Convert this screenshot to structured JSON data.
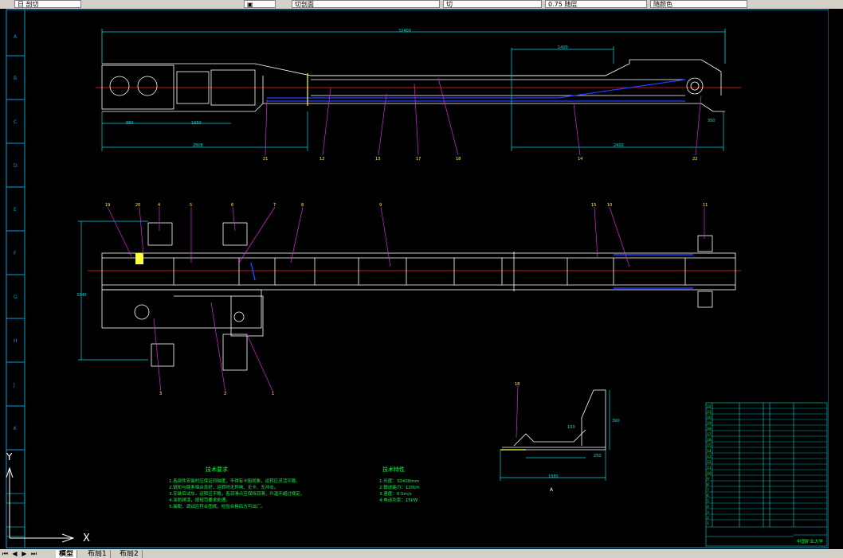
{
  "toolbar": {
    "seg1": "日 剖切",
    "seg2": "切剖面",
    "seg3": "切",
    "seg4": "0.75 随层",
    "seg5": "随颜色"
  },
  "drawing": {
    "dims": {
      "overall": "32400",
      "seg_1400": "1400",
      "seg_880": "880",
      "seg_1650": "1650",
      "seg_2808": "2808",
      "seg_2400": "2400",
      "seg_350": "350",
      "plan_width": "3340",
      "detail_1680": "1680",
      "detail_390": "390",
      "detail_250": "250",
      "detail_100": "100"
    },
    "callouts_top": [
      "21",
      "12",
      "13",
      "17",
      "18",
      "14",
      "22"
    ],
    "callouts_plan_top": [
      "19",
      "20",
      "4",
      "5",
      "6",
      "7",
      "8",
      "9",
      "15",
      "10",
      "11"
    ],
    "callouts_plan_bottom": [
      "3",
      "2",
      "1"
    ],
    "detail_callout": "18",
    "detail_label": "A",
    "tech_req": {
      "title": "技术要求",
      "lines": [
        "1.各部件安装时应保证同轴度，不得有卡阻现象，运转应灵活平稳。",
        "2.链轮与链条啮合良好，运转时无异响，无卡、无冲击。",
        "3.安装后试车，运转应平稳，各润滑点应保持润滑，升温不超过规定。",
        "4.涂防锈漆，按规范要求处理。",
        "5.装配、调试应符合图纸，检验合格后方可出厂。"
      ]
    },
    "tech_spec": {
      "title": "技术特性",
      "lines": [
        "1.长度：32400mm",
        "2.输送能力：120t/h",
        "3.速度：0.5m/s",
        "4.电动功率：15kW"
      ]
    },
    "title_block": {
      "company": "中国矿业大学",
      "rows": [
        "22",
        "21",
        "20",
        "19",
        "18",
        "17",
        "16",
        "15",
        "14",
        "13",
        "12",
        "11",
        "10",
        "9",
        "8",
        "7",
        "6",
        "5",
        "4",
        "3",
        "2",
        "1"
      ]
    }
  },
  "ucs": {
    "y": "Y",
    "x": "X"
  },
  "statusbar": {
    "tabs": [
      "模型",
      "布局1",
      "布局2"
    ],
    "active": 0
  },
  "colors": {
    "frame": "#00a0e0",
    "outline": "#ffffff",
    "center": "#ff2020",
    "dim": "#00d8d8",
    "leader": "#e020e0",
    "text_green": "#00ff40",
    "text_yellow": "#ffff40",
    "blue": "#2040ff"
  }
}
